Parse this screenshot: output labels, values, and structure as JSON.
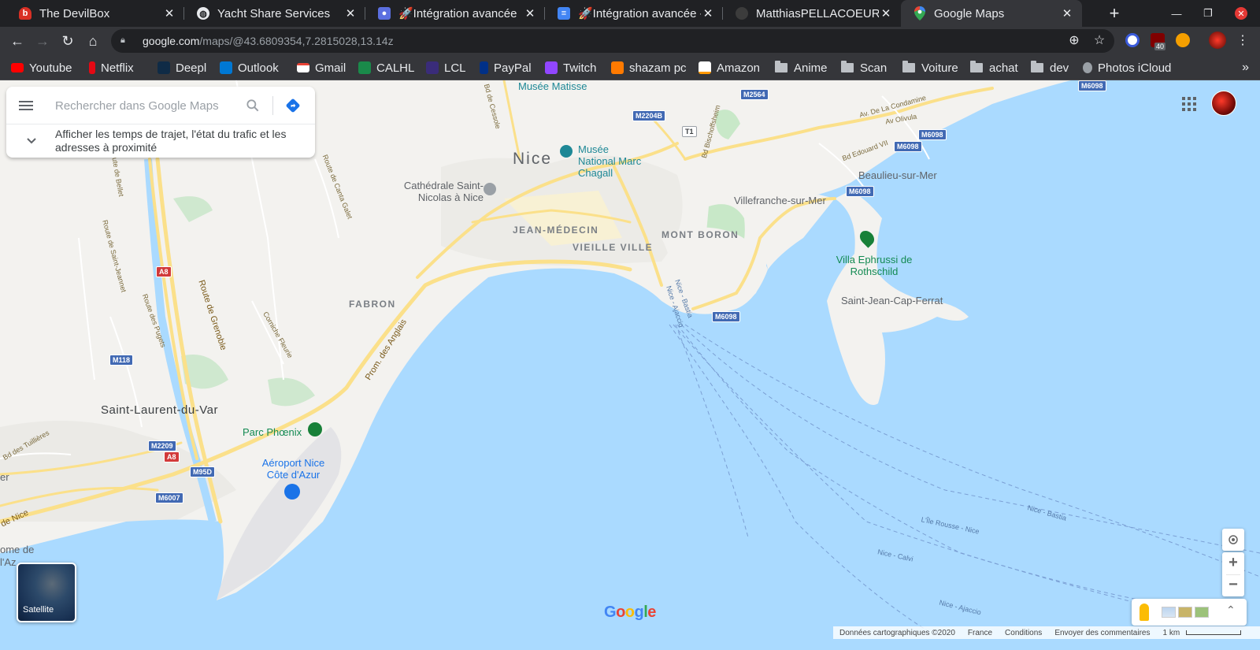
{
  "browser": {
    "tabs": [
      {
        "title": "The DevilBox",
        "icon": "devilbox-icon",
        "color": "#d93025"
      },
      {
        "title": "Yacht Share Services",
        "icon": "globe-icon",
        "color": "#9aa0a6"
      },
      {
        "title": "🚀Intégration avancée",
        "icon": "contact-icon",
        "color": "#5b6fe0"
      },
      {
        "title": "🚀Intégration avancée -",
        "icon": "docs-icon",
        "color": "#4285f4"
      },
      {
        "title": "MatthiasPELLACOEUR/y",
        "icon": "github-icon",
        "color": "#3c3c3c"
      },
      {
        "title": "Google Maps",
        "icon": "maps-pin-icon",
        "color": "#34a853"
      }
    ],
    "url_host": "google.com",
    "url_path": "/maps/@43.6809354,7.2815028,13.14z",
    "extension_badge": "40"
  },
  "bookmarks": [
    {
      "label": "Youtube",
      "color": "#ff0000"
    },
    {
      "label": "Netflix",
      "color": "#e50914"
    },
    {
      "label": "Deepl",
      "color": "#0f2b46"
    },
    {
      "label": "Outlook",
      "color": "#0078d4"
    },
    {
      "label": "Gmail",
      "color": "#ea4335"
    },
    {
      "label": "CALHL",
      "color": "#1a8a4a"
    },
    {
      "label": "LCL",
      "color": "#3a2c7a"
    },
    {
      "label": "PayPal",
      "color": "#003087"
    },
    {
      "label": "Twitch",
      "color": "#9146ff"
    },
    {
      "label": "shazam pc",
      "color": "#ff7a00"
    },
    {
      "label": "Amazon",
      "color": "#ffffff"
    },
    {
      "label": "Anime",
      "folder": true
    },
    {
      "label": "Scan",
      "folder": true
    },
    {
      "label": "Voiture",
      "folder": true
    },
    {
      "label": "achat",
      "folder": true
    },
    {
      "label": "dev",
      "folder": true
    },
    {
      "label": "Photos iCloud",
      "color": "#9aa0a6"
    }
  ],
  "search": {
    "placeholder": "Rechercher dans Google Maps",
    "traffic_text": "Afficher les temps de trajet, l'état du trafic et les adresses à proximité"
  },
  "map": {
    "city_labels": [
      "Nice",
      "Saint-Laurent-du-Var"
    ],
    "districts": [
      "JEAN-MÉDECIN",
      "VIEILLE VILLE",
      "MONT BORON",
      "FABRON"
    ],
    "places": [
      "Beaulieu-sur-Mer",
      "Villefranche-sur-Mer",
      "Saint-Jean-Cap-Ferrat",
      "ome de",
      "l'Az",
      "er"
    ],
    "pois": {
      "matisse": "Musée Matisse",
      "chagall": "Musée National Marc Chagall",
      "cathedrale": "Cathédrale Saint-Nicolas à Nice",
      "ephrussi": "Villa Ephrussi de Rothschild",
      "phoenix": "Parc Phœnix",
      "airport": "Aéroport Nice Côte d'Azur"
    },
    "roads": [
      "Route de Grenoble",
      "Prom. des Anglais",
      "Route de Canta Galet",
      "Av. De La Condamine",
      "Av Olivula",
      "Bd Edouard VII",
      "Bd Bischoffsheim",
      "Bd de Cessole",
      "Corniche Fleurie",
      "Route des Pugets",
      "Route de Saint-Jeannet",
      "Route de Bellet",
      "de Nice",
      "Bd des Tuillières"
    ],
    "shields": [
      "M2564",
      "M2204B",
      "T1",
      "M6098",
      "M6098",
      "M6098",
      "M6098",
      "M6098",
      "A8",
      "M118",
      "M2209",
      "A8",
      "M95D",
      "M6007"
    ],
    "ferries": [
      "Nice - Bastia",
      "L'Île Rousse - Nice",
      "Nice - Calvi",
      "Nice - Ajaccio",
      "Nice - Bastia",
      "Nice - Ajaccio"
    ],
    "water_color": "#aadaff",
    "land_color": "#f3f2ef"
  },
  "controls": {
    "satellite_label": "Satellite",
    "zoom_in": "+",
    "zoom_out": "−"
  },
  "footer": {
    "data": "Données cartographiques ©2020",
    "country": "France",
    "terms": "Conditions",
    "feedback": "Envoyer des commentaires",
    "scale": "1 km"
  },
  "logo": {
    "letters": [
      "G",
      "o",
      "o",
      "g",
      "l",
      "e"
    ],
    "colors": [
      "#4285f4",
      "#ea4335",
      "#fbbc05",
      "#4285f4",
      "#34a853",
      "#ea4335"
    ]
  }
}
